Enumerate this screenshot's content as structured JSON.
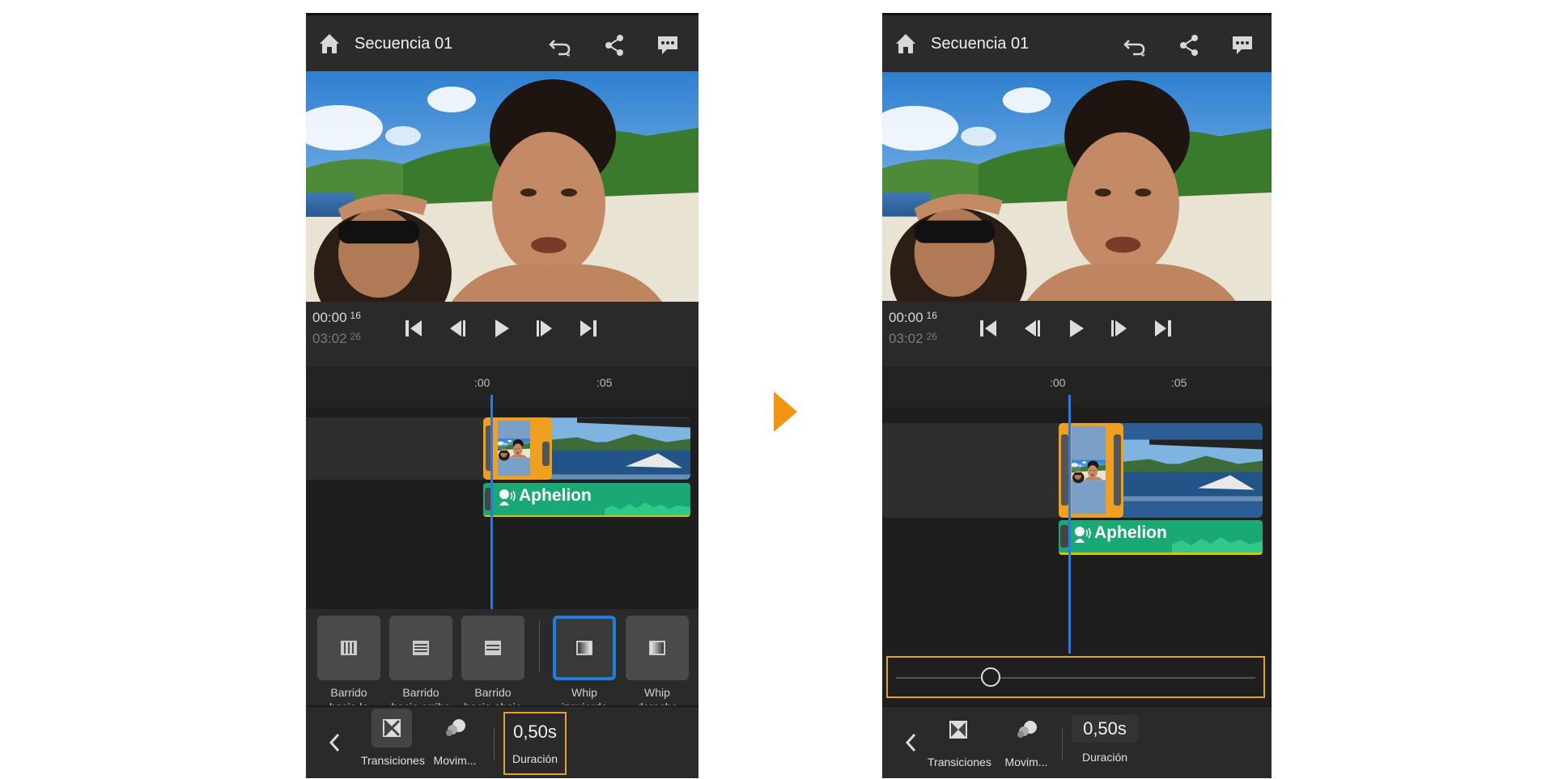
{
  "panels": [
    {
      "header": {
        "title": "Secuencia 01"
      },
      "timecode": {
        "current": "00:00",
        "current_frames": "16",
        "total": "03:02",
        "total_frames": "26"
      },
      "ruler": {
        "tick1": ":00",
        "tick2": ":05"
      },
      "audio_clip": {
        "label": "Aphelion"
      },
      "presets": [
        {
          "line1": "Barrido",
          "line2": "hacia la"
        },
        {
          "line1": "Barrido",
          "line2": "hacia arriba"
        },
        {
          "line1": "Barrido",
          "line2": "hacia abajo"
        },
        {
          "line1": "Whip",
          "line2": "izquierda"
        },
        {
          "line1": "Whip",
          "line2": "derecha"
        }
      ],
      "toolbar": {
        "transitions_label": "Transiciones",
        "motion_label": "Movim...",
        "duration_value": "0,50s",
        "duration_label": "Duración"
      }
    },
    {
      "header": {
        "title": "Secuencia 01"
      },
      "timecode": {
        "current": "00:00",
        "current_frames": "16",
        "total": "03:02",
        "total_frames": "26"
      },
      "ruler": {
        "tick1": ":00",
        "tick2": ":05"
      },
      "audio_clip": {
        "label": "Aphelion"
      },
      "duration_slider": {
        "value_fraction": 0.25
      },
      "toolbar": {
        "transitions_label": "Transiciones",
        "motion_label": "Movim...",
        "duration_value": "0,50s",
        "duration_label": "Duración"
      }
    }
  ],
  "colors": {
    "accent_orange": "#f29411",
    "selection_blue": "#1d7fe0",
    "audio_green": "#1aa874",
    "highlight_border": "#e3a32a"
  },
  "icons": [
    "home-icon",
    "undo-icon",
    "share-icon",
    "comment-icon",
    "skip-start-icon",
    "step-back-icon",
    "play-icon",
    "step-forward-icon",
    "skip-end-icon",
    "chevron-left-icon",
    "transitions-icon",
    "motion-icon",
    "speaker-icon"
  ]
}
